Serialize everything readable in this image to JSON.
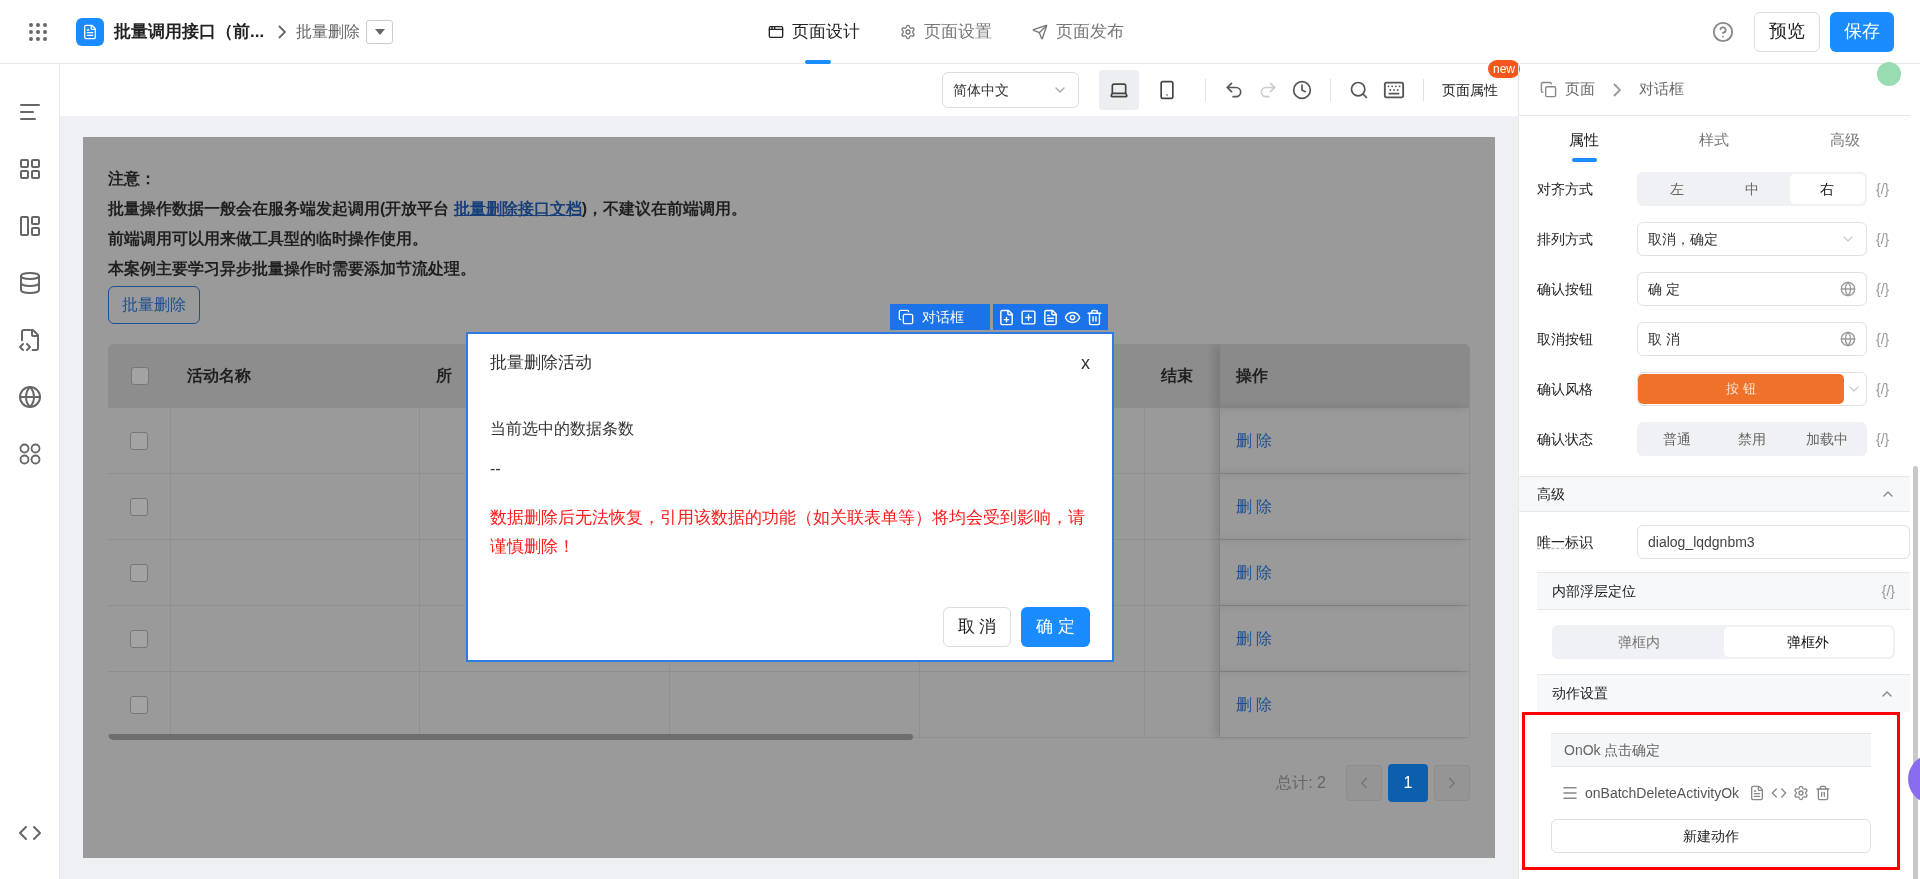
{
  "topbar": {
    "app_title": "批量调用接口（前...",
    "page_name": "批量删除",
    "tabs": [
      {
        "label": "页面设计",
        "selected": true
      },
      {
        "label": "页面设置",
        "selected": false
      },
      {
        "label": "页面发布",
        "selected": false
      }
    ],
    "preview": "预览",
    "save": "保存"
  },
  "toolbar": {
    "language": "简体中文",
    "devices": [
      {
        "kind": "desktop",
        "selected": true
      },
      {
        "kind": "mobile",
        "selected": false
      }
    ],
    "redo_disabled": true,
    "page_props": "页面属性",
    "badge": "new"
  },
  "canvas": {
    "notice_title": "注意：",
    "notice_line": {
      "before": "批量操作数据一般会在服务端发起调用(开放平台 ",
      "link": "批量删除接口文档",
      "after": ")，不建议在前端调用。"
    },
    "notice_lines": [
      "前端调用可以用来做工具型的临时操作使用。",
      "本案例主要学习异步批量操作时需要添加节流处理。"
    ],
    "batch_button": "批量删除",
    "table": {
      "header_checked": false,
      "columns": [
        "活动名称",
        "所",
        "结束",
        "操作"
      ],
      "rows": [
        {
          "checked": false,
          "action": "删 除"
        },
        {
          "checked": false,
          "action": "删 除"
        },
        {
          "checked": false,
          "action": "删 除"
        },
        {
          "checked": false,
          "action": "删 除"
        },
        {
          "checked": false,
          "action": "删 除"
        }
      ]
    },
    "pagination": {
      "total": "总计: 2",
      "pages": [
        {
          "label": "1",
          "selected": true
        }
      ]
    },
    "dialog_tag": "对话框",
    "dialog": {
      "title": "批量删除活动",
      "close": "x",
      "field_label": "当前选中的数据条数",
      "field_value": "--",
      "warning": "数据删除后无法恢复，引用该数据的功能（如关联表单等）将均会受到影响，请谨慎删除！",
      "cancel": "取 消",
      "ok": "确 定"
    }
  },
  "panel": {
    "breadcrumb": [
      "页面",
      "对话框"
    ],
    "tabs": [
      {
        "label": "属性",
        "selected": true
      },
      {
        "label": "样式",
        "selected": false
      },
      {
        "label": "高级",
        "selected": false
      }
    ],
    "props": [
      {
        "kind": "segmented",
        "label": "对齐方式",
        "options": [
          {
            "label": "左",
            "selected": false
          },
          {
            "label": "中",
            "selected": false
          },
          {
            "label": "右",
            "selected": true
          }
        ]
      },
      {
        "kind": "select",
        "label": "排列方式",
        "value": "取消，确定"
      },
      {
        "kind": "i18n",
        "label": "确认按钮",
        "value": "确 定"
      },
      {
        "kind": "i18n",
        "label": "取消按钮",
        "value": "取 消"
      },
      {
        "kind": "style",
        "label": "确认风格",
        "value": "按 钮"
      },
      {
        "kind": "segmented",
        "label": "确认状态",
        "options": [
          {
            "label": "普通",
            "selected": false
          },
          {
            "label": "禁用",
            "selected": false
          },
          {
            "label": "加载中",
            "selected": false
          }
        ]
      }
    ],
    "binding": "{/}",
    "advanced": {
      "title": "高级",
      "expanded": true,
      "id_label": "唯一标识",
      "id_value": "dialog_lqdgnbm3",
      "layer_title": "内部浮层定位",
      "layer_options": [
        {
          "label": "弹框内",
          "selected": false
        },
        {
          "label": "弹框外",
          "selected": true
        }
      ],
      "actions_title": "动作设置",
      "actions_expanded": true,
      "event": "OnOk 点击确定",
      "handlers": [
        "onBatchDeleteActivityOk"
      ],
      "new_action": "新建动作"
    }
  }
}
